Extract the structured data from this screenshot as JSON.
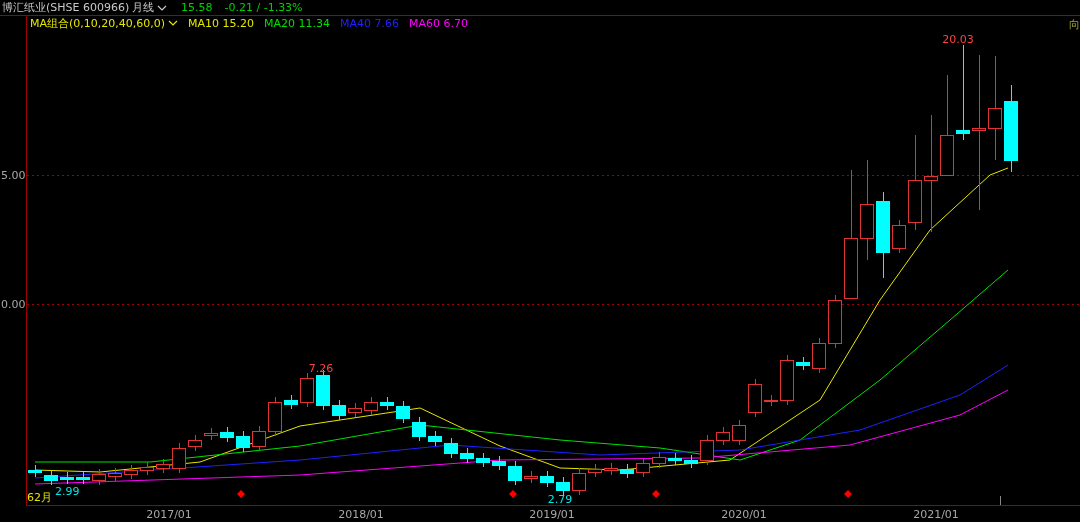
{
  "header": {
    "title": "博汇纸业(SHSE 600966)",
    "period": "月线",
    "price": "15.58",
    "change": "-0.21 / -1.33%"
  },
  "legend": {
    "label": "MA组合(0,10,20,40,60,0)",
    "items": [
      {
        "name": "MA10",
        "value": "15.20",
        "color": "#e6e600"
      },
      {
        "name": "MA20",
        "value": "11.34",
        "color": "#00e000"
      },
      {
        "name": "MA40",
        "value": "7.66",
        "color": "#2020ff"
      },
      {
        "name": "MA60",
        "value": "6.70",
        "color": "#ff00ff"
      }
    ]
  },
  "edge_text": "向",
  "y_axis_labels": [
    "5.00",
    "0.00"
  ],
  "x_axis_labels": [
    "2017/01",
    "2018/01",
    "2019/01",
    "2020/01",
    "2021/01"
  ],
  "price_labels": [
    {
      "text": "20.03",
      "kind": "high"
    },
    {
      "text": "7.26",
      "kind": "high"
    },
    {
      "text": "2.79",
      "kind": "low"
    },
    {
      "text": "2.99",
      "kind": "low"
    }
  ],
  "period_count": "62月"
}
